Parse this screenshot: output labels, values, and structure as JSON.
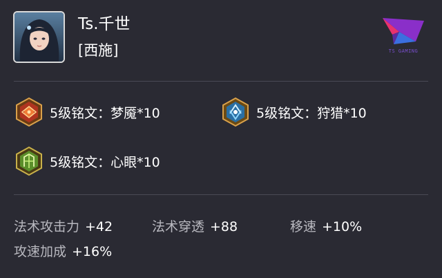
{
  "player": {
    "name": "Ts.千世",
    "hero": "[西施]"
  },
  "team_logo": {
    "text": "TS GAMING",
    "icon": "ts-gaming-logo"
  },
  "runes": [
    {
      "label": "5级铭文：梦魇*10",
      "icon": "red-rune-icon",
      "color": "#c8452a"
    },
    {
      "label": "5级铭文：狩猎*10",
      "icon": "blue-rune-icon",
      "color": "#3a8fc4"
    },
    {
      "label": "5级铭文：心眼*10",
      "icon": "green-rune-icon",
      "color": "#6fa83a"
    }
  ],
  "stats": [
    {
      "label": "法术攻击力",
      "value": "+42"
    },
    {
      "label": "法术穿透",
      "value": "+88"
    },
    {
      "label": "移速",
      "value": "+10%"
    },
    {
      "label": "攻速加成",
      "value": "+16%"
    }
  ]
}
